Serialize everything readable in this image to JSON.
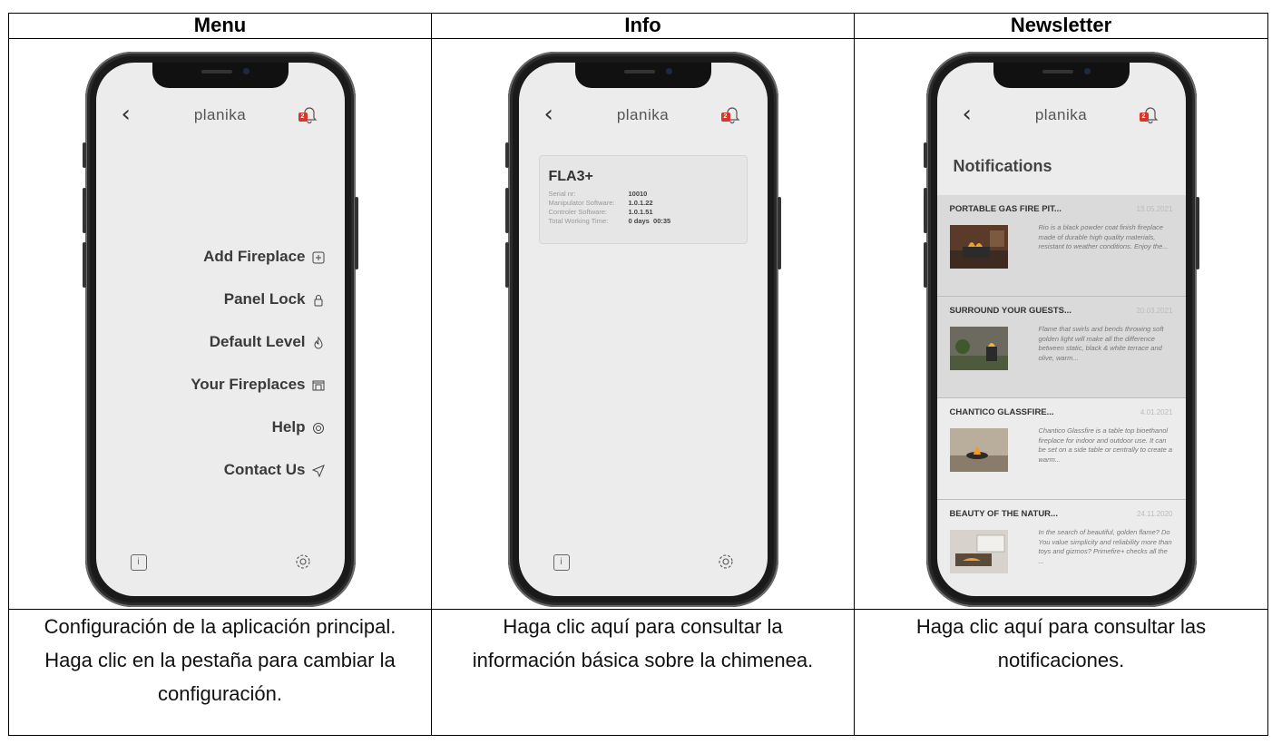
{
  "columns": [
    {
      "header": "Menu",
      "caption": "Configuración de la aplicación principal. Haga clic en la pestaña para cambiar la configuración."
    },
    {
      "header": "Info",
      "caption": "Haga clic aquí para consultar la información básica sobre la chimenea."
    },
    {
      "header": "Newsletter",
      "caption": "Haga clic aquí para consultar las notificaciones."
    }
  ],
  "app": {
    "brand": "planika",
    "back_icon": "chevron-left-icon",
    "bell_icon": "bell-icon",
    "bell_badge": "2",
    "info_icon": "info-icon",
    "settings_icon": "gear-icon",
    "accent_color": "#d9362b"
  },
  "menu": {
    "items": [
      {
        "label": "Add Fireplace",
        "icon": "plus-box-icon"
      },
      {
        "label": "Panel Lock",
        "icon": "lock-icon"
      },
      {
        "label": "Default Level",
        "icon": "flame-icon"
      },
      {
        "label": "Your Fireplaces",
        "icon": "fireplace-icon"
      },
      {
        "label": "Help",
        "icon": "lifebuoy-icon"
      },
      {
        "label": "Contact Us",
        "icon": "send-icon"
      }
    ]
  },
  "info": {
    "device": "FLA3+",
    "rows": [
      {
        "key": "Serial nr:",
        "value": "10010"
      },
      {
        "key": "Manipulator Software:",
        "value": "1.0.1.22"
      },
      {
        "key": "Controler Software:",
        "value": "1.0.1.51"
      },
      {
        "key": "Total Working Time:",
        "value": "0 days  00:35"
      }
    ]
  },
  "newsletter": {
    "title": "Notifications",
    "items": [
      {
        "headline": "PORTABLE GAS FIRE PIT...",
        "date": "13.05.2021",
        "text": "Rio is a black powder coat finish fireplace made of durable high quality materials, resistant to weather conditions. Enjoy the..."
      },
      {
        "headline": "SURROUND YOUR GUESTS...",
        "date": "20.03.2021",
        "text": "Flame that swirls and bends throwing soft golden light will make all the difference between static, black & white terrace and olive, warm..."
      },
      {
        "headline": "CHANTICO GLASSFIRE...",
        "date": "4.01.2021",
        "text": "Chantico Glassfire is a table top bioethanol fireplace for indoor and outdoor use. It can be set on a side table or centrally to create a warm..."
      },
      {
        "headline": "BEAUTY OF THE NATUR...",
        "date": "24.11.2020",
        "text": "In the search of beautiful, golden flame? Do You value simplicity and reliability more than toys and gizmos? Primefire+ checks all the ..."
      }
    ]
  }
}
